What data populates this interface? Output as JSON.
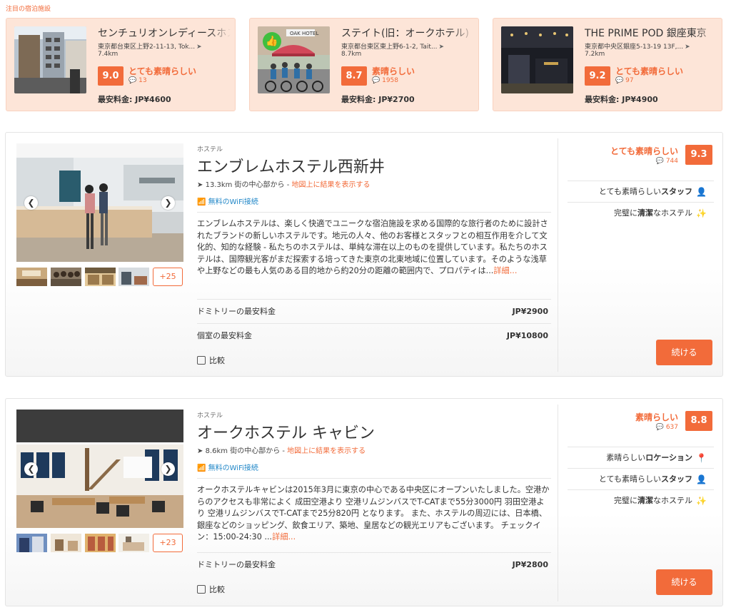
{
  "featured_label": "注目の宿泊施設",
  "featured": [
    {
      "name": "センチュリオンレディースホステル上野公園",
      "address": "東京都台東区上野2-11-13, Tok...",
      "distance": "7.4km",
      "score": "9.0",
      "rating_word": "とても素晴らしい",
      "reviews": "13",
      "price": "最安料金: JP¥4600",
      "badge": ""
    },
    {
      "name": "ステイト(旧：オークホテル)",
      "address": "東京都台東区東上野6-1-2, Tait...",
      "distance": "8.7km",
      "score": "8.7",
      "rating_word": "素晴らしい",
      "reviews": "1958",
      "price": "最安料金: JP¥2700",
      "badge": "thumbs-up"
    },
    {
      "name": "THE PRIME POD 銀座東京",
      "address": "東京都中央区銀座5-13-19 13F,...",
      "distance": "7.2km",
      "score": "9.2",
      "rating_word": "とても素晴らしい",
      "reviews": "97",
      "price": "最安料金: JP¥4900",
      "badge": ""
    }
  ],
  "listings": [
    {
      "type": "ホステル",
      "name": "エンブレムホステル西新井",
      "distance": "13.3km 街の中心部から - ",
      "map_link": "地図上に結果を表示する",
      "wifi": "無料のWiFi接続",
      "description": "エンブレムホステルは、楽しく快適でユニークな宿泊施設を求める国際的な旅行者のために設計されたブランドの新しいホステルです。地元の人々、他のお客様とスタッフとの相互作用を介して文化的、知的な経験 - 私たちのホステルは、単純な滞在以上のものを提供しています。私たちのホステルは、国際観光客がまだ探索する培ってきた東京の北東地域に位置しています。そのような浅草や上野などの最も人気のある目的地から約20分の距離の範囲内で、プロパティは...",
      "more": "詳細...",
      "price_rows": [
        {
          "label": "ドミトリーの最安料金",
          "value": "JP¥2900"
        },
        {
          "label": "個室の最安料金",
          "value": "JP¥10800"
        }
      ],
      "compare": "比較",
      "rating_word": "とても素晴らしい",
      "reviews": "744",
      "score": "9.3",
      "features": [
        {
          "pre": "とても素晴らしい",
          "bold": "スタッフ",
          "post": "",
          "icon": "staff-icon",
          "glyph": "👤",
          "color": "#26a24f"
        },
        {
          "pre": "完璧に",
          "bold": "清潔",
          "post": "なホステル",
          "icon": "cleanliness-icon",
          "glyph": "✨",
          "color": "#27a2d8"
        }
      ],
      "more_photos": "+25",
      "continue": "続ける"
    },
    {
      "type": "ホステル",
      "name": "オークホステル キャビン",
      "distance": "8.6km 街の中心部から - ",
      "map_link": "地図上に結果を表示する",
      "wifi": "無料のWiFi接続",
      "description": "オークホステルキャビンは2015年3月に東京の中心である中央区にオープンいたしました。空港からのアクセスも非常によく 成田空港より 空港リムジンバスでT-CATまで55分3000円 羽田空港より 空港リムジンバスでT-CATまで25分820円 となります。 また、ホステルの周辺には、日本橋、銀座などのショッピング、飲食エリア、築地、皇居などの観光エリアもございます。 チェックイン：15:00-24:30 ...",
      "more": "詳細...",
      "price_rows": [
        {
          "label": "ドミトリーの最安料金",
          "value": "JP¥2800"
        }
      ],
      "compare": "比較",
      "rating_word": "素晴らしい",
      "reviews": "637",
      "score": "8.8",
      "features": [
        {
          "pre": "素晴らしい",
          "bold": "ロケーション",
          "post": "",
          "icon": "location-pin-icon",
          "glyph": "📍",
          "color": "#f26b3a"
        },
        {
          "pre": "とても素晴らしい",
          "bold": "スタッフ",
          "post": "",
          "icon": "staff-icon",
          "glyph": "👤",
          "color": "#26a24f"
        },
        {
          "pre": "完璧に",
          "bold": "清潔",
          "post": "なホステル",
          "icon": "cleanliness-icon",
          "glyph": "✨",
          "color": "#27a2d8"
        }
      ],
      "more_photos": "+23",
      "continue": "続ける"
    }
  ]
}
